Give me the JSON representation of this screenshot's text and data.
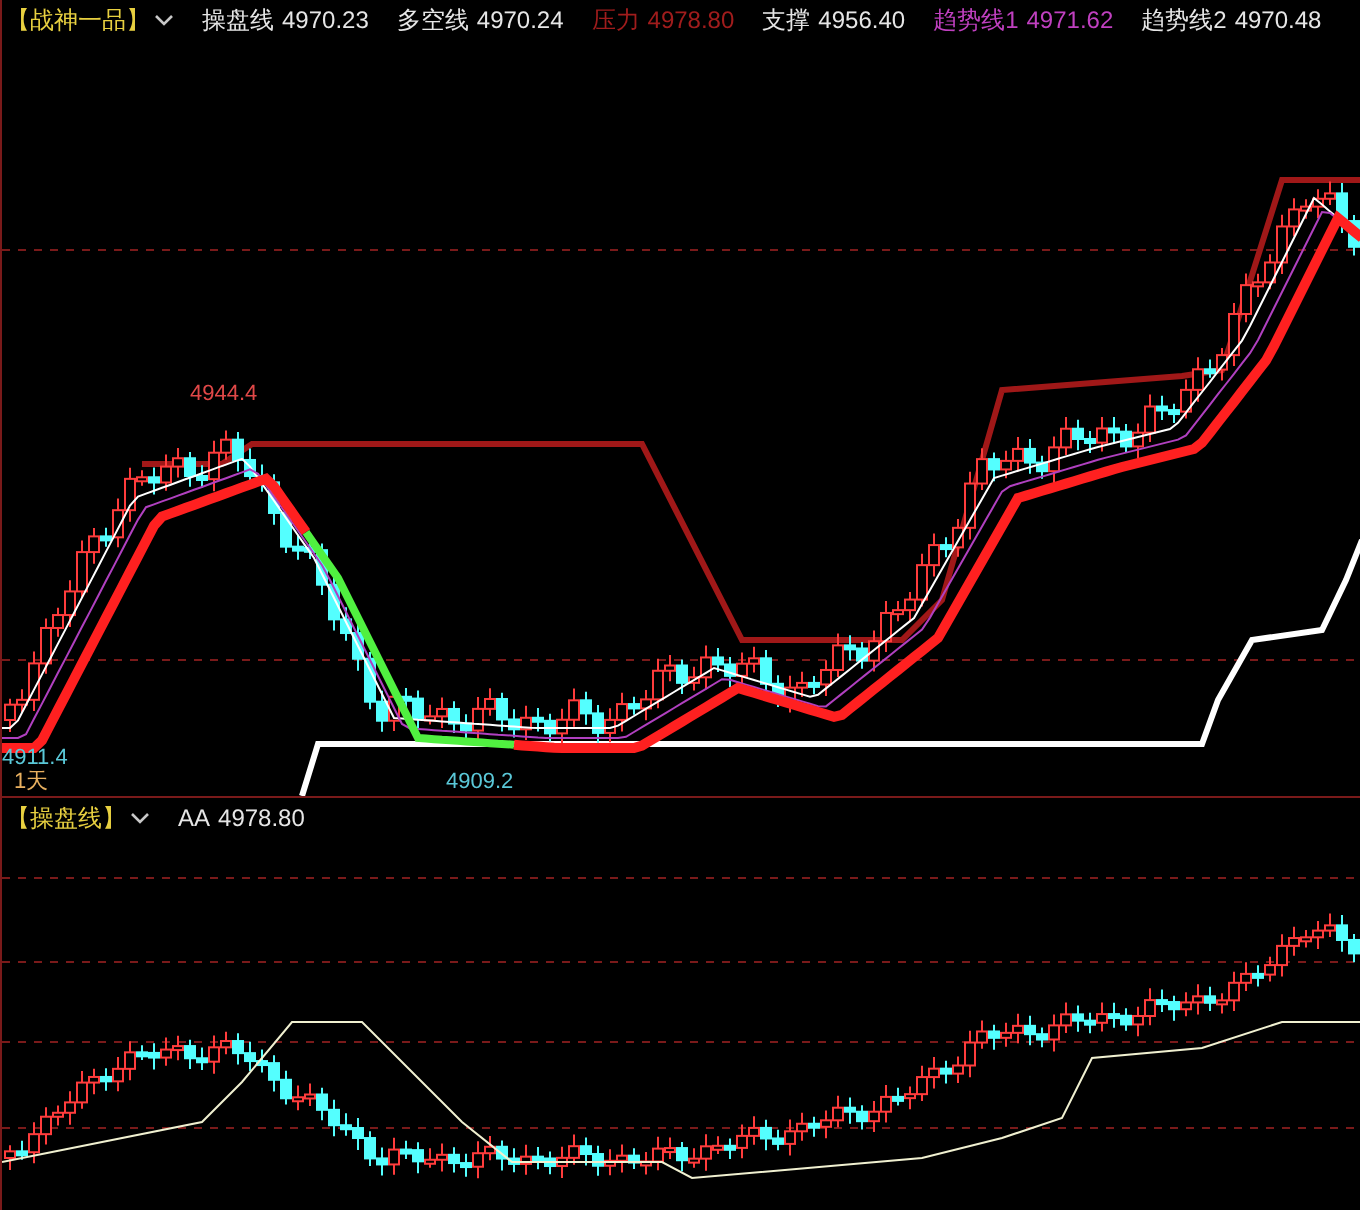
{
  "main_panel": {
    "indicator": "【战神一品】",
    "items": [
      {
        "label": "操盘线",
        "value": "4970.23",
        "color": "#e6e6e6"
      },
      {
        "label": "多空线",
        "value": "4970.24",
        "color": "#e6e6e6"
      },
      {
        "label": "压力",
        "value": "4978.80",
        "color": "#a01c1c"
      },
      {
        "label": "支撑",
        "value": "4956.40",
        "color": "#e6e6e6"
      },
      {
        "label": "趋势线1",
        "value": "4971.62",
        "color": "#c040c0"
      },
      {
        "label": "趋势线2",
        "value": "4970.48",
        "color": "#e6e6e6"
      }
    ],
    "annotations": [
      {
        "text": "4944.4",
        "color": "#e04848"
      },
      {
        "text": "4911.4",
        "color": "#5ac8d8"
      },
      {
        "text": "4909.2",
        "color": "#5ac8d8"
      },
      {
        "text": "1天",
        "color": "#e8b060"
      }
    ]
  },
  "lower_panel": {
    "indicator": "【操盘线】",
    "items": [
      {
        "label": "AA",
        "value": "4978.80",
        "color": "#e6e6e6"
      }
    ]
  }
}
